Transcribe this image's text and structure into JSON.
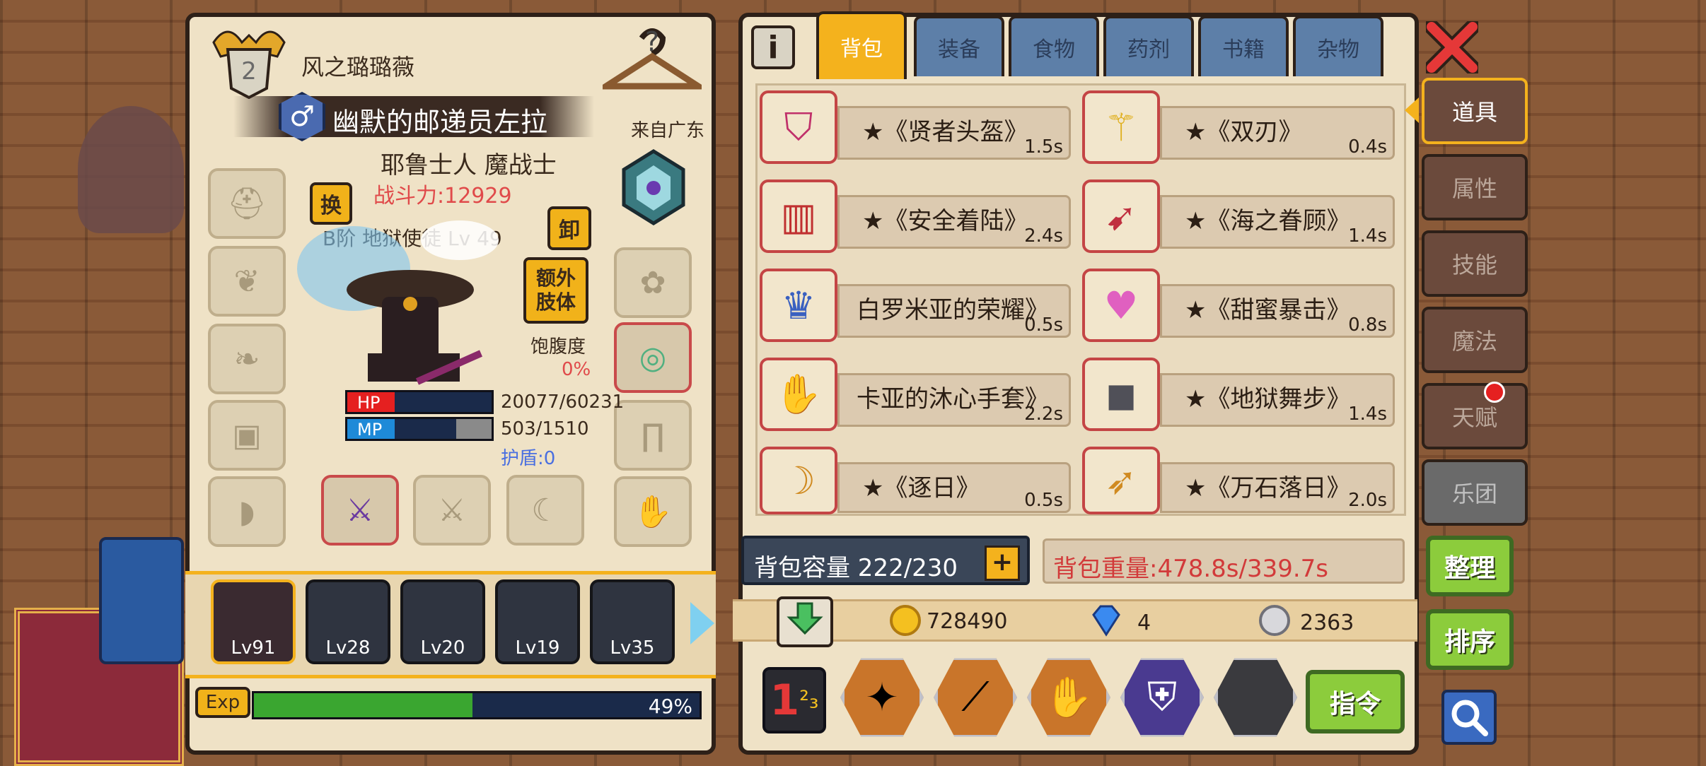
{
  "colors": {
    "accent": "#f4b21d",
    "combat_power": "#e04a4a",
    "shield": "#4a6fe0",
    "hp": "#e52020",
    "mp": "#1e8ad8",
    "exp": "#3aa630",
    "weight_text": "#d23a3a"
  },
  "character": {
    "player_name": "风之璐璐薇",
    "title": "幽默的邮递员左拉",
    "origin": "来自广东",
    "race_class": "耶鲁士人 魔战士",
    "combat_power": "战斗力:12929",
    "pet_info": "B阶 地狱使徒 Lv 49",
    "swap_label": "换",
    "unequip_label": "卸",
    "extra_limb_label": "额外肢体",
    "satiety_label": "饱腹度",
    "satiety_value": "0%",
    "hp_label": "HP",
    "hp_value": "20077/60231",
    "hp_fraction": 0.33,
    "mp_label": "MP",
    "mp_value": "503/1510",
    "mp_fraction": 0.33,
    "shield": "护盾:0",
    "equip_slots_left": [
      "helmet-slot-icon",
      "necklace-slot-icon",
      "cape-slot-icon",
      "armor-slot-icon",
      "boots-slot-icon"
    ],
    "equip_slots_right": [
      "hair-slot-icon",
      "ring-slot-icon",
      "leg-slot-icon",
      "gloves-slot-icon"
    ],
    "equip_slots_bottom": [
      "sword-slot-icon",
      "offhand-slot-icon",
      "charm-slot-icon"
    ]
  },
  "party": [
    {
      "level": "Lv91",
      "selected": true
    },
    {
      "level": "Lv28",
      "selected": false
    },
    {
      "level": "Lv20",
      "selected": false
    },
    {
      "level": "Lv19",
      "selected": false
    },
    {
      "level": "Lv35",
      "selected": false
    }
  ],
  "exp": {
    "label": "Exp",
    "value": "49%",
    "fraction": 0.49
  },
  "inventory": {
    "tabs": [
      {
        "label": "背包",
        "active": true
      },
      {
        "label": "装备",
        "active": false
      },
      {
        "label": "食物",
        "active": false
      },
      {
        "label": "药剂",
        "active": false
      },
      {
        "label": "书籍",
        "active": false
      },
      {
        "label": "杂物",
        "active": false
      }
    ],
    "items": [
      {
        "name": "★《贤者头盔》",
        "weight": "1.5s",
        "icon": "helmet-icon"
      },
      {
        "name": "★《双刃》",
        "weight": "0.4s",
        "icon": "blade-icon"
      },
      {
        "name": "★《安全着陆》",
        "weight": "2.4s",
        "icon": "jetpack-icon"
      },
      {
        "name": "★《海之眷顾》",
        "weight": "1.4s",
        "icon": "spear-icon"
      },
      {
        "name": "白罗米亚的荣耀》",
        "weight": "0.5s",
        "icon": "crown-icon"
      },
      {
        "name": "★《甜蜜暴击》",
        "weight": "0.8s",
        "icon": "heart-ring-icon"
      },
      {
        "name": "卡亚的沐心手套》",
        "weight": "2.2s",
        "icon": "glove-icon"
      },
      {
        "name": "★《地狱舞步》",
        "weight": "1.4s",
        "icon": "boots-icon"
      },
      {
        "name": "★《逐日》",
        "weight": "0.5s",
        "icon": "bow-icon"
      },
      {
        "name": "★《万石落日》",
        "weight": "2.0s",
        "icon": "bow-icon"
      }
    ],
    "capacity": "背包容量 222/230",
    "weight": "背包重量:478.8s/339.7s",
    "gold": "728490",
    "diamonds": "4",
    "silver": "2363",
    "command_label": "指令"
  },
  "side_tabs": [
    {
      "label": "道具",
      "active": true
    },
    {
      "label": "属性",
      "active": false
    },
    {
      "label": "技能",
      "active": false
    },
    {
      "label": "魔法",
      "active": false
    },
    {
      "label": "天赋",
      "active": false,
      "badge": true
    },
    {
      "label": "乐团",
      "active": false
    }
  ],
  "buttons": {
    "sort": "整理",
    "order": "排序"
  }
}
